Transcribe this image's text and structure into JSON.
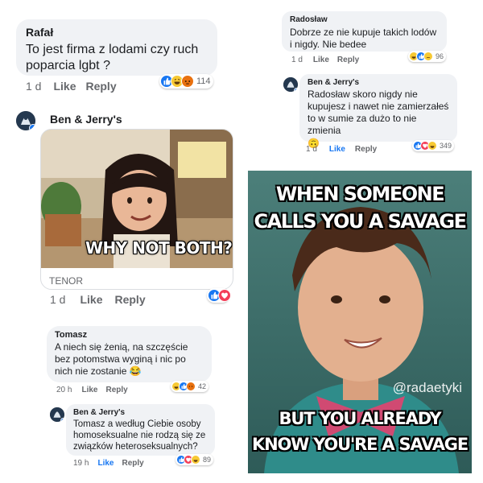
{
  "thread_left": {
    "comment1": {
      "author": "Rafał",
      "text": "To jest firma z lodami czy ruch poparcia lgbt ?",
      "time": "1 d",
      "like": "Like",
      "reply": "Reply",
      "reaction_count": "114"
    },
    "brand_reply": {
      "author": "Ben & Jerry's",
      "gif_caption": "WHY NOT BOTH?",
      "gif_source": "TENOR",
      "time": "1 d",
      "like": "Like",
      "reply": "Reply"
    },
    "comment2": {
      "author": "Tomasz",
      "text": "A niech się żenią, na szczęście bez potomstwa wyginą i nic po nich nie zostanie 😂",
      "time": "20 h",
      "like": "Like",
      "reply": "Reply",
      "reaction_count": "42"
    },
    "brand_reply2": {
      "author": "Ben & Jerry's",
      "text": "Tomasz a według Ciebie osoby homoseksualne nie rodzą się ze związków heteroseksualnych?",
      "time": "19 h",
      "like": "Like",
      "reply": "Reply",
      "reaction_count": "89"
    }
  },
  "thread_right": {
    "comment1": {
      "author": "Radosław",
      "text": "Dobrze ze nie kupuje takich  lodów i nigdy. Nie bedee",
      "time": "1 d",
      "like": "Like",
      "reply": "Reply",
      "reaction_count": "96"
    },
    "brand_reply": {
      "author": "Ben & Jerry's",
      "text": "Radosław skoro nigdy nie kupujesz  i nawet nie zamierzałeś to w sumie za dużo to nie zmienia",
      "emoji": "🙃",
      "time": "1 d",
      "like": "Like",
      "reply": "Reply",
      "reaction_count": "349"
    }
  },
  "meme": {
    "top_text": "WHEN SOMEONE CALLS YOU A SAVAGE",
    "watermark": "@radaetyki",
    "bottom_text": "BUT YOU ALREADY KNOW YOU'RE A SAVAGE"
  },
  "colors": {
    "bubble": "#f0f2f5",
    "facebook_blue": "#1877f2",
    "meta_grey": "#65676b"
  },
  "icons": [
    "like-reaction-icon",
    "laugh-reaction-icon",
    "angry-reaction-icon",
    "love-reaction-icon",
    "verified-badge-icon"
  ]
}
